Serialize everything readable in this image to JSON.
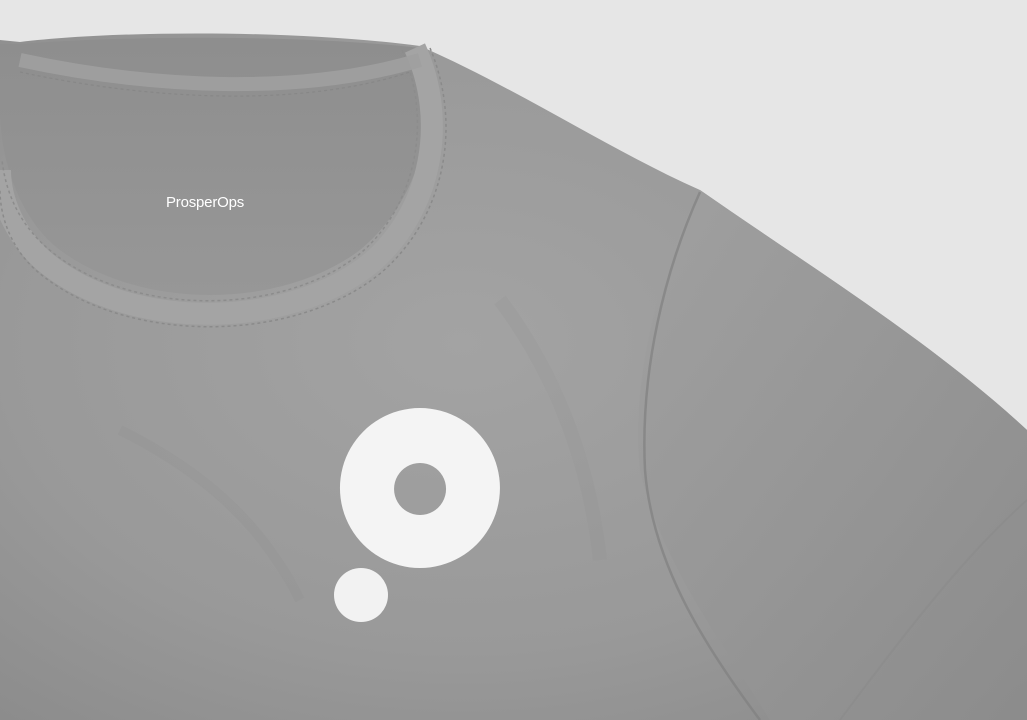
{
  "photo": {
    "subject": "grey-tshirt-mockup",
    "background_color": "#e6e6e6",
    "shirt_color": "#9a9a9a",
    "print_color": "#ffffff"
  },
  "neck_label": {
    "text": "ProsperOps"
  },
  "chest_logo": {
    "icon": "prosperops-mark-icon"
  }
}
